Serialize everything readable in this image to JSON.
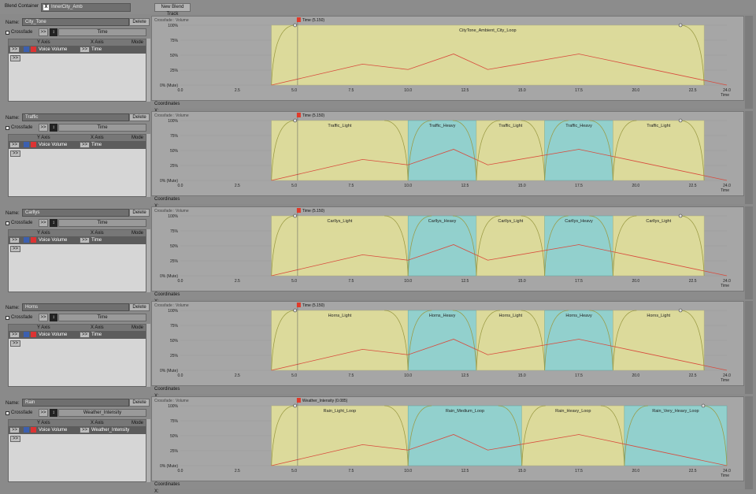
{
  "toolbar": {
    "blend_container_label": "Blend Container",
    "container_value": "InnerCity_Amb",
    "close_glyph": "X",
    "new_blend_track_label": "New Blend Track"
  },
  "common": {
    "name_label": "Name:",
    "delete_label": "Delete",
    "crossfade_label": "Crossfade",
    "arrow_label": ">>",
    "y_axis_header": "Y Axis",
    "x_axis_header": "X Axis",
    "mode_header": "Mode",
    "voice_volume": "Voice Volume",
    "coordinates_label": "Coordinates",
    "x_label": "X:",
    "y_label": "Y:",
    "graph_header": "Crossfade : Volume",
    "time_label": "Time",
    "y_ticks": [
      "100%",
      "75%",
      "50%",
      "25%",
      "0% (Mute)"
    ],
    "x_ticks": [
      "0.0",
      "2.5",
      "5.0",
      "7.5",
      "10.0",
      "12.5",
      "15.0",
      "17.5",
      "20.0",
      "22.5",
      "24.0"
    ]
  },
  "tracks": [
    {
      "name": "City_Tone",
      "x_axis": "Time",
      "cursor_label": "Time (5.150)",
      "segments": [
        {
          "label": "CityTone_Ambient_City_Loop",
          "start": 4.0,
          "end": 23.0,
          "color": "yellow"
        }
      ]
    },
    {
      "name": "Traffic",
      "x_axis": "Time",
      "cursor_label": "Time (5.150)",
      "segments": [
        {
          "label": "Traffic_Light",
          "start": 4.0,
          "end": 10.0,
          "color": "yellow"
        },
        {
          "label": "Traffic_Heavy",
          "start": 10.0,
          "end": 13.0,
          "color": "cyan"
        },
        {
          "label": "Traffic_Light",
          "start": 13.0,
          "end": 16.0,
          "color": "yellow"
        },
        {
          "label": "Traffic_Heavy",
          "start": 16.0,
          "end": 19.0,
          "color": "cyan"
        },
        {
          "label": "Traffic_Light",
          "start": 19.0,
          "end": 23.0,
          "color": "yellow"
        }
      ]
    },
    {
      "name": "Carllys",
      "x_axis": "Time",
      "cursor_label": "Time (5.150)",
      "segments": [
        {
          "label": "Carllys_Light",
          "start": 4.0,
          "end": 10.0,
          "color": "yellow"
        },
        {
          "label": "Carllys_Heavy",
          "start": 10.0,
          "end": 13.0,
          "color": "cyan"
        },
        {
          "label": "Carllys_Light",
          "start": 13.0,
          "end": 16.0,
          "color": "yellow"
        },
        {
          "label": "Carllys_Heavy",
          "start": 16.0,
          "end": 19.0,
          "color": "cyan"
        },
        {
          "label": "Carllys_Light",
          "start": 19.0,
          "end": 23.0,
          "color": "yellow"
        }
      ]
    },
    {
      "name": "Horns",
      "x_axis": "Time",
      "cursor_label": "Time (5.150)",
      "segments": [
        {
          "label": "Horns_Light",
          "start": 4.0,
          "end": 10.0,
          "color": "yellow"
        },
        {
          "label": "Horns_Heavy",
          "start": 10.0,
          "end": 13.0,
          "color": "cyan"
        },
        {
          "label": "Horns_Light",
          "start": 13.0,
          "end": 16.0,
          "color": "yellow"
        },
        {
          "label": "Horns_Heavy",
          "start": 16.0,
          "end": 19.0,
          "color": "cyan"
        },
        {
          "label": "Horns_Light",
          "start": 19.0,
          "end": 23.0,
          "color": "yellow"
        }
      ]
    },
    {
      "name": "Rain",
      "x_axis": "Weather_Intensity",
      "cursor_label": "Weather_Intensity (0.085)",
      "segments": [
        {
          "label": "Rain_Light_Loop",
          "start": 4.0,
          "end": 10.0,
          "color": "yellow"
        },
        {
          "label": "Rain_Medium_Loop",
          "start": 10.0,
          "end": 15.0,
          "color": "cyan"
        },
        {
          "label": "Rain_Heavy_Loop",
          "start": 15.0,
          "end": 19.5,
          "color": "yellow"
        },
        {
          "label": "Rain_Very_Heavy_Loop",
          "start": 19.5,
          "end": 24.0,
          "color": "cyan"
        }
      ]
    }
  ],
  "colors": {
    "yellow_fill": "#e6e49a",
    "cyan_fill": "#8fd8d4",
    "curve": "#d84a3c",
    "fade_curve": "#9a9a44",
    "cursor_marker": "#e03a2a"
  }
}
